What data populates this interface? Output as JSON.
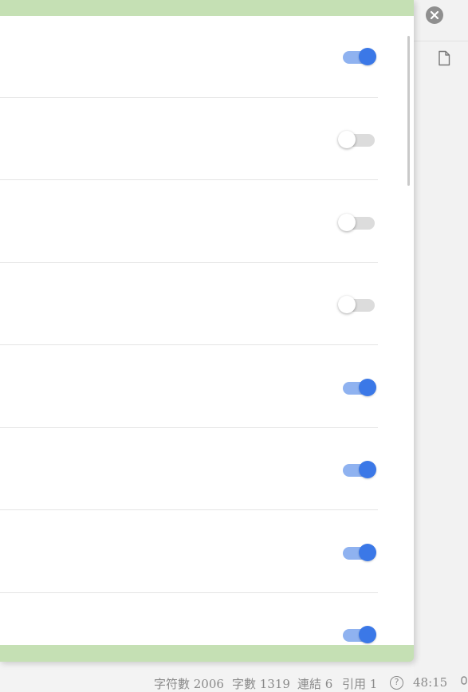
{
  "toggles": [
    {
      "state": "on"
    },
    {
      "state": "off"
    },
    {
      "state": "off"
    },
    {
      "state": "off"
    },
    {
      "state": "on"
    },
    {
      "state": "on"
    },
    {
      "state": "on"
    },
    {
      "state": "on"
    }
  ],
  "icons": {
    "close": "close-icon",
    "file": "file-icon",
    "help": "help-icon",
    "mic": "microphone-icon"
  },
  "colors": {
    "modal_frame": "#c5e0b4",
    "toggle_on": "#3b78e7",
    "toggle_on_track": "#8fb2f0",
    "toggle_off_track": "#dcdcdc"
  },
  "status_bar": {
    "char_count": "字符數 2006",
    "word_count": "字數 1319",
    "links": "連結 6",
    "citations": "引用 1",
    "help_glyph": "?",
    "time": "48:15"
  }
}
